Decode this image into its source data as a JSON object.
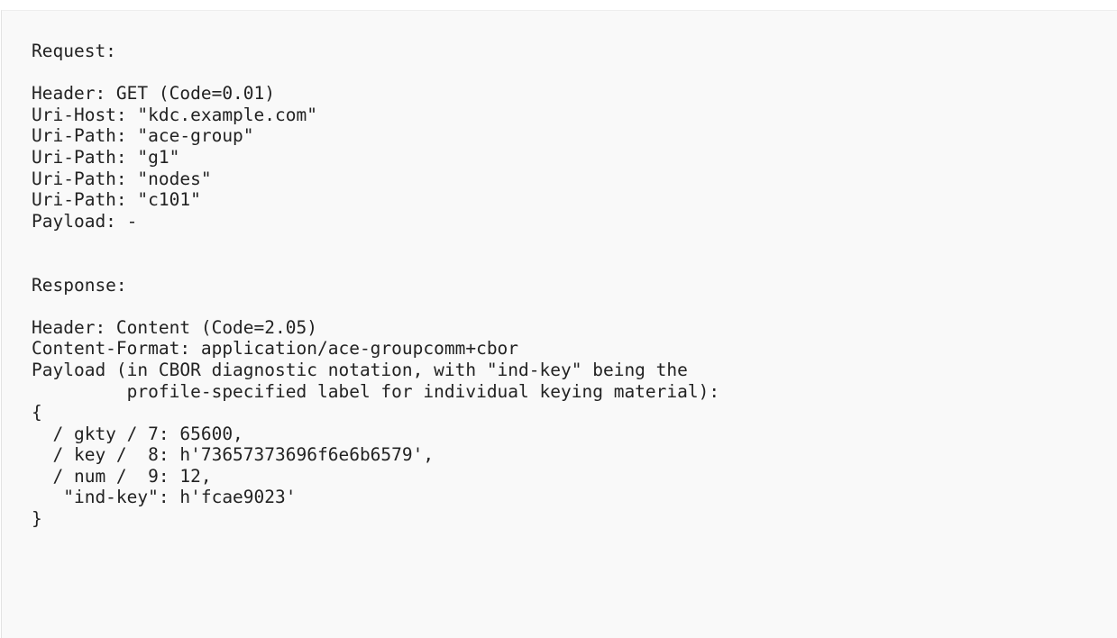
{
  "code": {
    "lines": [
      "Request:",
      "",
      "Header: GET (Code=0.01)",
      "Uri-Host: \"kdc.example.com\"",
      "Uri-Path: \"ace-group\"",
      "Uri-Path: \"g1\"",
      "Uri-Path: \"nodes\"",
      "Uri-Path: \"c101\"",
      "Payload: -",
      "",
      "",
      "Response:",
      "",
      "Header: Content (Code=2.05)",
      "Content-Format: application/ace-groupcomm+cbor",
      "Payload (in CBOR diagnostic notation, with \"ind-key\" being the",
      "         profile-specified label for individual keying material):",
      "{",
      "  / gkty / 7: 65600,",
      "  / key /  8: h'73657373696f6e6b6579',",
      "  / num /  9: 12,",
      "   \"ind-key\": h'fcae9023'",
      "}"
    ]
  }
}
